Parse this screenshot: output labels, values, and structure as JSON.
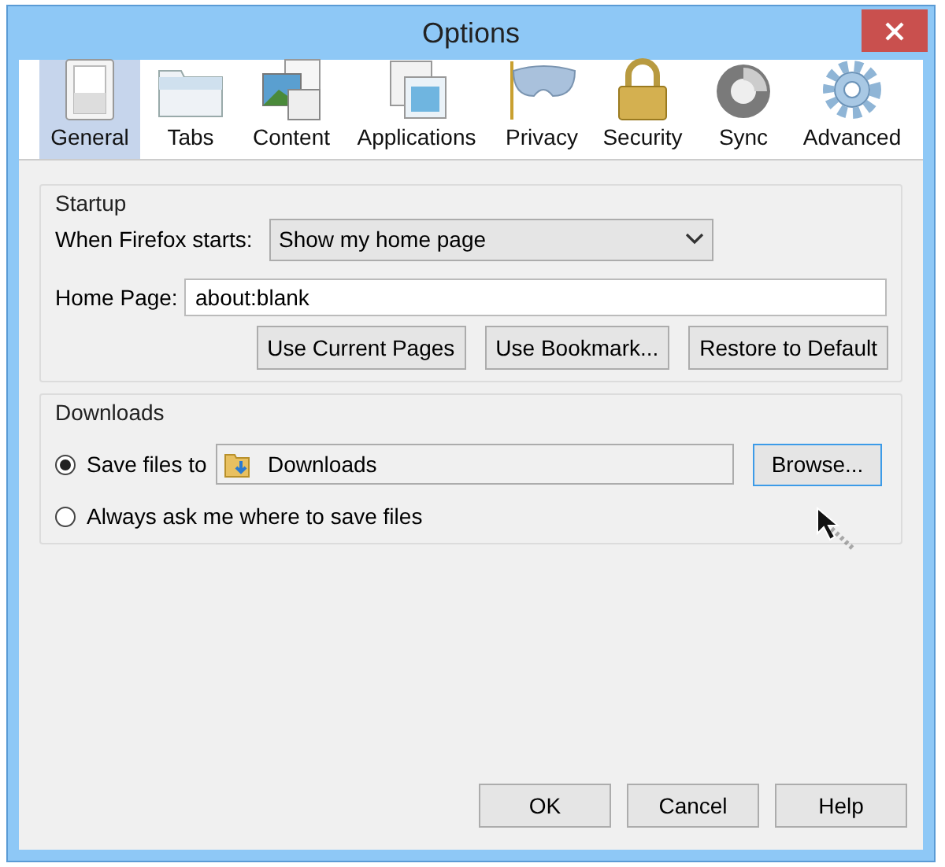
{
  "window": {
    "title": "Options"
  },
  "tabs": [
    {
      "label": "General",
      "selected": true
    },
    {
      "label": "Tabs",
      "selected": false
    },
    {
      "label": "Content",
      "selected": false
    },
    {
      "label": "Applications",
      "selected": false
    },
    {
      "label": "Privacy",
      "selected": false
    },
    {
      "label": "Security",
      "selected": false
    },
    {
      "label": "Sync",
      "selected": false
    },
    {
      "label": "Advanced",
      "selected": false
    }
  ],
  "startup": {
    "title": "Startup",
    "when_label": "When Firefox starts:",
    "when_value": "Show my home page",
    "home_label": "Home Page:",
    "home_value": "about:blank",
    "buttons": [
      "Use Current Pages",
      "Use Bookmark...",
      "Restore to Default"
    ]
  },
  "downloads": {
    "title": "Downloads",
    "options": [
      {
        "label": "Save files to",
        "selected": true,
        "folder": "Downloads",
        "button": "Browse..."
      },
      {
        "label": "Always ask me where to save files",
        "selected": false
      }
    ]
  },
  "buttons": [
    "OK",
    "Cancel",
    "Help"
  ]
}
